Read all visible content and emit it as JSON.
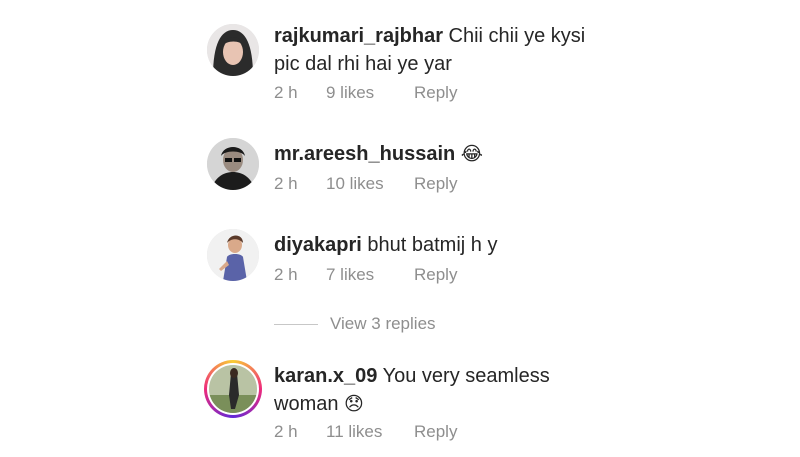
{
  "comments": [
    {
      "username": "rajkumari_rajbhar",
      "text": "Chii chii ye kysi",
      "text2": "pic dal rhi hai ye yar",
      "time": "2 h",
      "likes": "9 likes",
      "reply": "Reply"
    },
    {
      "username": "mr.areesh_hussain",
      "emoji": "😂",
      "time": "2 h",
      "likes": "10 likes",
      "reply": "Reply"
    },
    {
      "username": "diyakapri",
      "text": "bhut batmij h y",
      "time": "2 h",
      "likes": "7 likes",
      "reply": "Reply"
    },
    {
      "username": "karan.x_09",
      "text": "You very seamless",
      "text2": "woman",
      "emoji": "😞",
      "time": "2 h",
      "likes": "11 likes",
      "reply": "Reply"
    }
  ],
  "view_replies": "View 3 replies"
}
